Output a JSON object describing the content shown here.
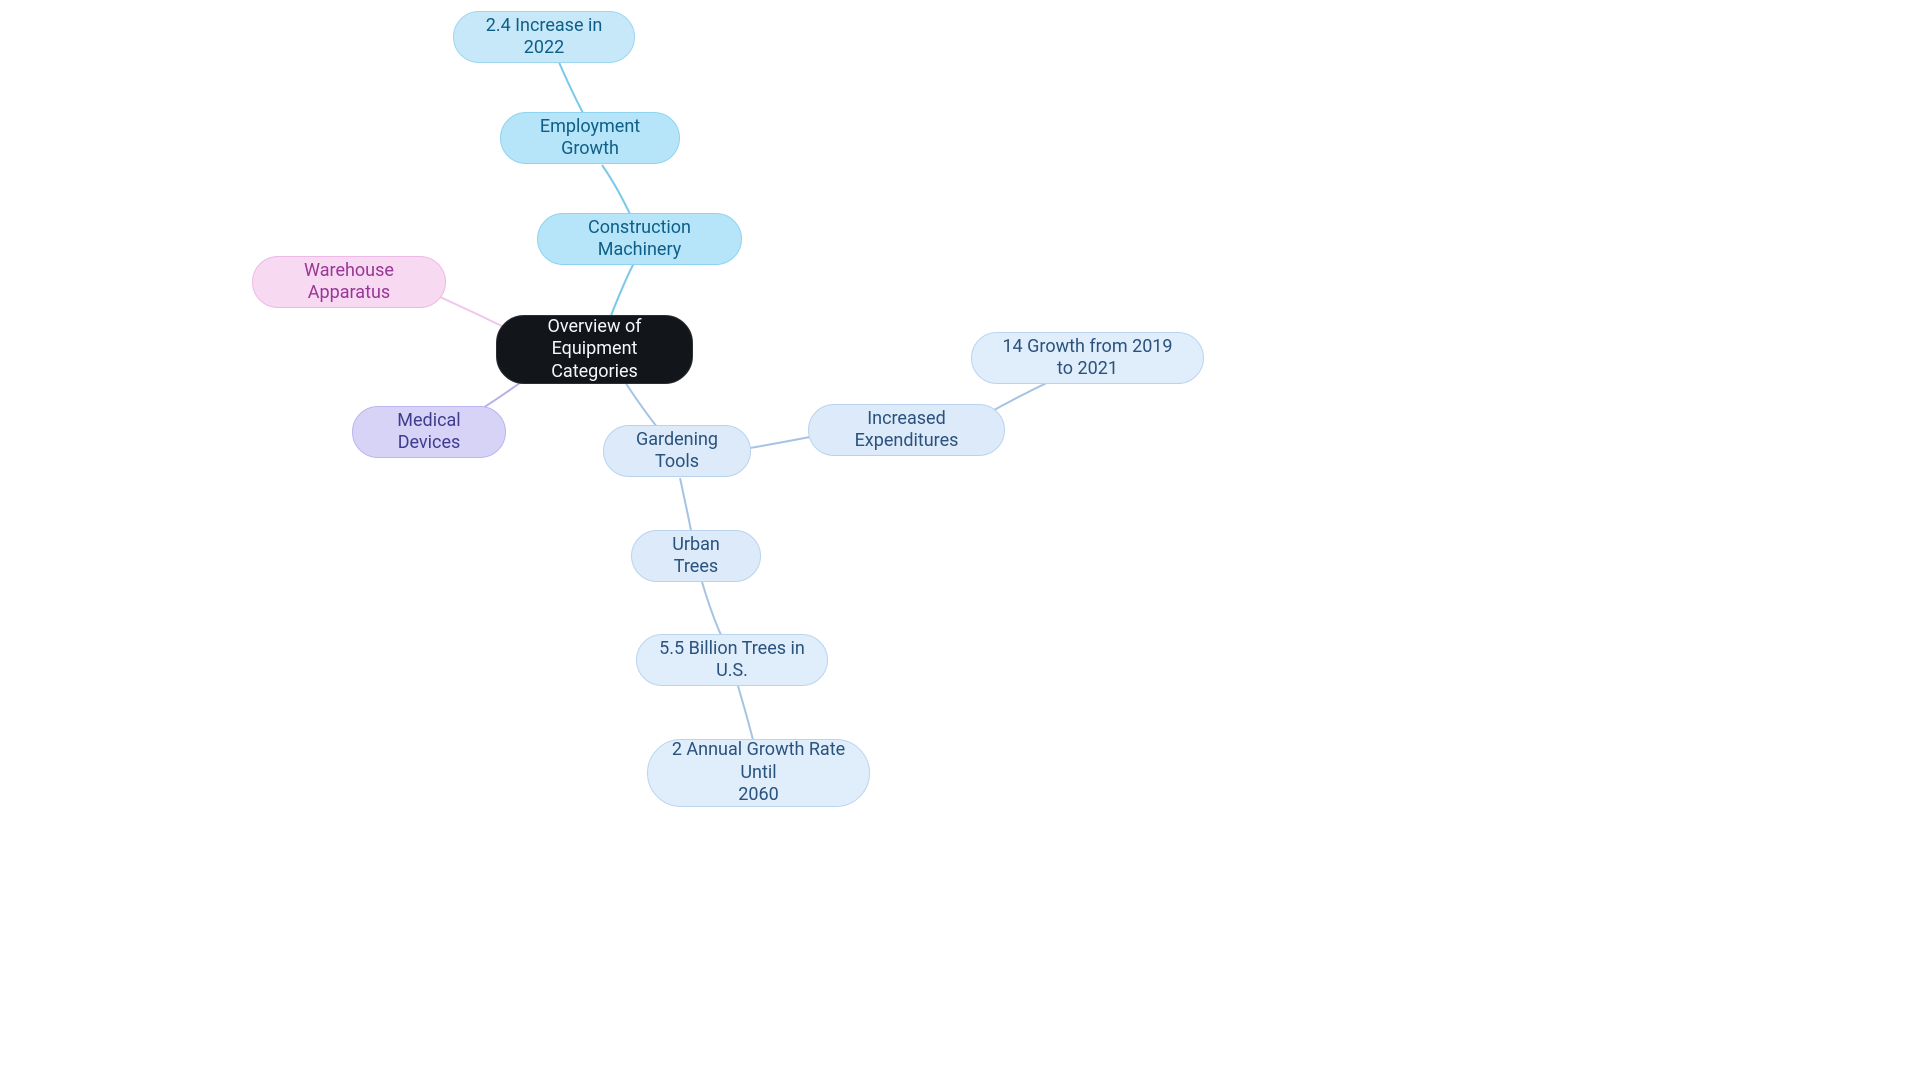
{
  "nodes": {
    "root": {
      "label": "Overview of Equipment\nCategories"
    },
    "warehouse": {
      "label": "Warehouse Apparatus"
    },
    "medical": {
      "label": "Medical Devices"
    },
    "construction": {
      "label": "Construction Machinery"
    },
    "employment": {
      "label": "Employment Growth"
    },
    "increase2022": {
      "label": "2.4 Increase in 2022"
    },
    "gardening": {
      "label": "Gardening Tools"
    },
    "expenditures": {
      "label": "Increased Expenditures"
    },
    "growth2019": {
      "label": "14 Growth from 2019 to 2021"
    },
    "urbanTrees": {
      "label": "Urban Trees"
    },
    "trees55b": {
      "label": "5.5 Billion Trees in U.S."
    },
    "annualGrowth": {
      "label": "2 Annual Growth Rate Until\n2060"
    }
  },
  "colors": {
    "root_bg": "#12161b",
    "sky_bg": "#b6e4f8",
    "pale_bg": "#dceaf9",
    "lavender_bg": "#d6d3f7",
    "pink_bg": "#f7d9f2",
    "edge_sky": "#79c9ea",
    "edge_pale": "#a6c3e4",
    "edge_lav": "#b6b2e8",
    "edge_pink": "#f0c6ea"
  }
}
